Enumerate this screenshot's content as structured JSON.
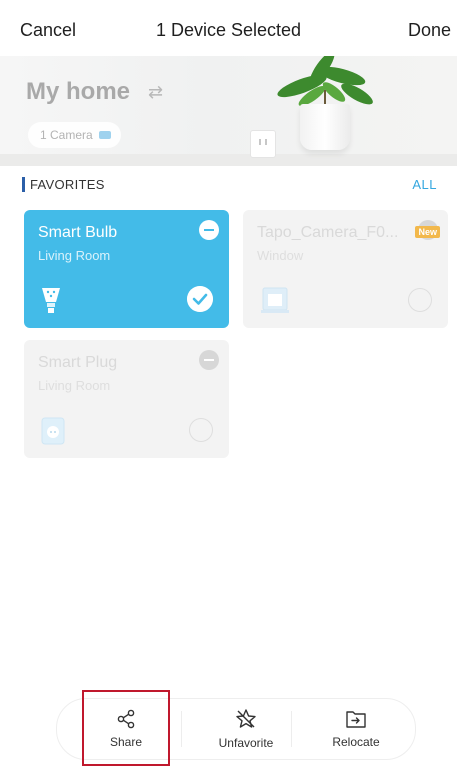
{
  "nav": {
    "cancel_label": "Cancel",
    "title": "1 Device Selected",
    "done_label": "Done"
  },
  "header": {
    "home_name": "My home",
    "switch_icon": "swap-icon",
    "camera_pill": "1 Camera",
    "camera_icon": "camera-icon"
  },
  "favorites": {
    "label": "FAVORITES",
    "all_label": "ALL"
  },
  "devices": [
    {
      "name": "Smart Bulb",
      "room": "Living Room",
      "icon": "bulb-icon",
      "selected": true
    },
    {
      "name": "Tapo_Camera_F0...",
      "room": "Window",
      "icon": "camera-icon",
      "badge": "New",
      "selected": false
    },
    {
      "name": "Smart Plug",
      "room": "Living Room",
      "icon": "plug-icon",
      "selected": false
    }
  ],
  "actions": {
    "share": "Share",
    "unfavorite": "Unfavorite",
    "relocate": "Relocate"
  },
  "colors": {
    "accent": "#43bbe8",
    "link": "#35a7df",
    "highlight_box": "#c0182d"
  }
}
